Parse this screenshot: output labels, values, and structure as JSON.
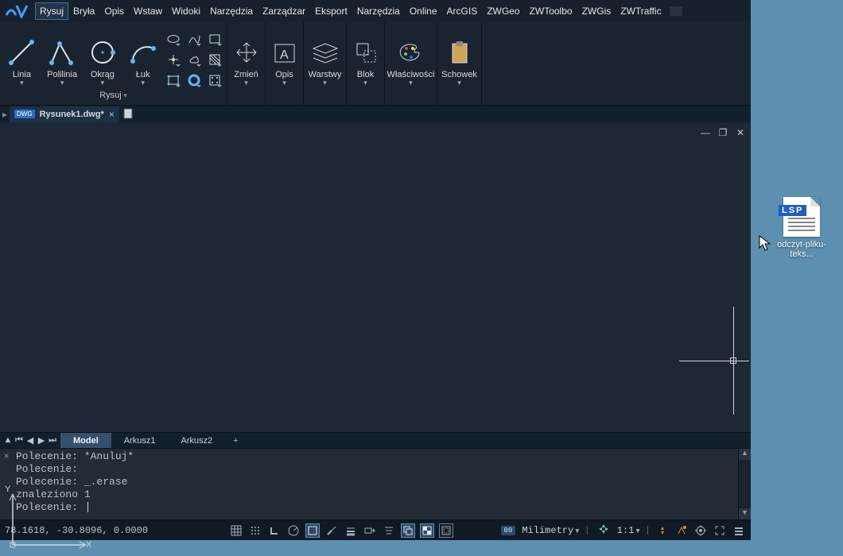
{
  "menubar": {
    "items": [
      "Rysuj",
      "Bryła",
      "Opis",
      "Wstaw",
      "Widoki",
      "Narzędzia",
      "Zarządzar",
      "Eksport",
      "Narzędzia",
      "Online",
      "ArcGIS",
      "ZWGeo",
      "ZWToolbo",
      "ZWGis",
      "ZWTraffic"
    ],
    "active_index": 0
  },
  "ribbon": {
    "panel_draw": {
      "title": "Rysuj",
      "tools": {
        "line": "Linia",
        "polyline": "Polilinia",
        "circle": "Okrąg",
        "arc": "Łuk"
      }
    },
    "panel_modify": {
      "title": "Zmień"
    },
    "panel_annot": {
      "title": "Opis"
    },
    "panel_layers": {
      "title": "Warstwy"
    },
    "panel_block": {
      "title": "Blok"
    },
    "panel_props": {
      "title": "Właściwości"
    },
    "panel_clip": {
      "title": "Schowek"
    }
  },
  "doc_tabs": {
    "badge": "DWG",
    "name": "Rysunek1.dwg*"
  },
  "ucs": {
    "x": "X",
    "y": "Y"
  },
  "layout_tabs": {
    "items": [
      "Model",
      "Arkusz1",
      "Arkusz2"
    ],
    "active_index": 0,
    "add": "+"
  },
  "command": {
    "lines": [
      "Polecenie: *Anuluj*",
      "Polecenie: ",
      "Polecenie: _.erase",
      "znaleziono 1",
      "Polecenie: "
    ]
  },
  "status": {
    "coords": "78.1618, -30.8096, 0.0000",
    "units_badge": "00",
    "units": "Milimetry",
    "scale": "1:1"
  },
  "desktop": {
    "file_type": "LSP",
    "file_label": "odczyt-pliku-teks..."
  }
}
